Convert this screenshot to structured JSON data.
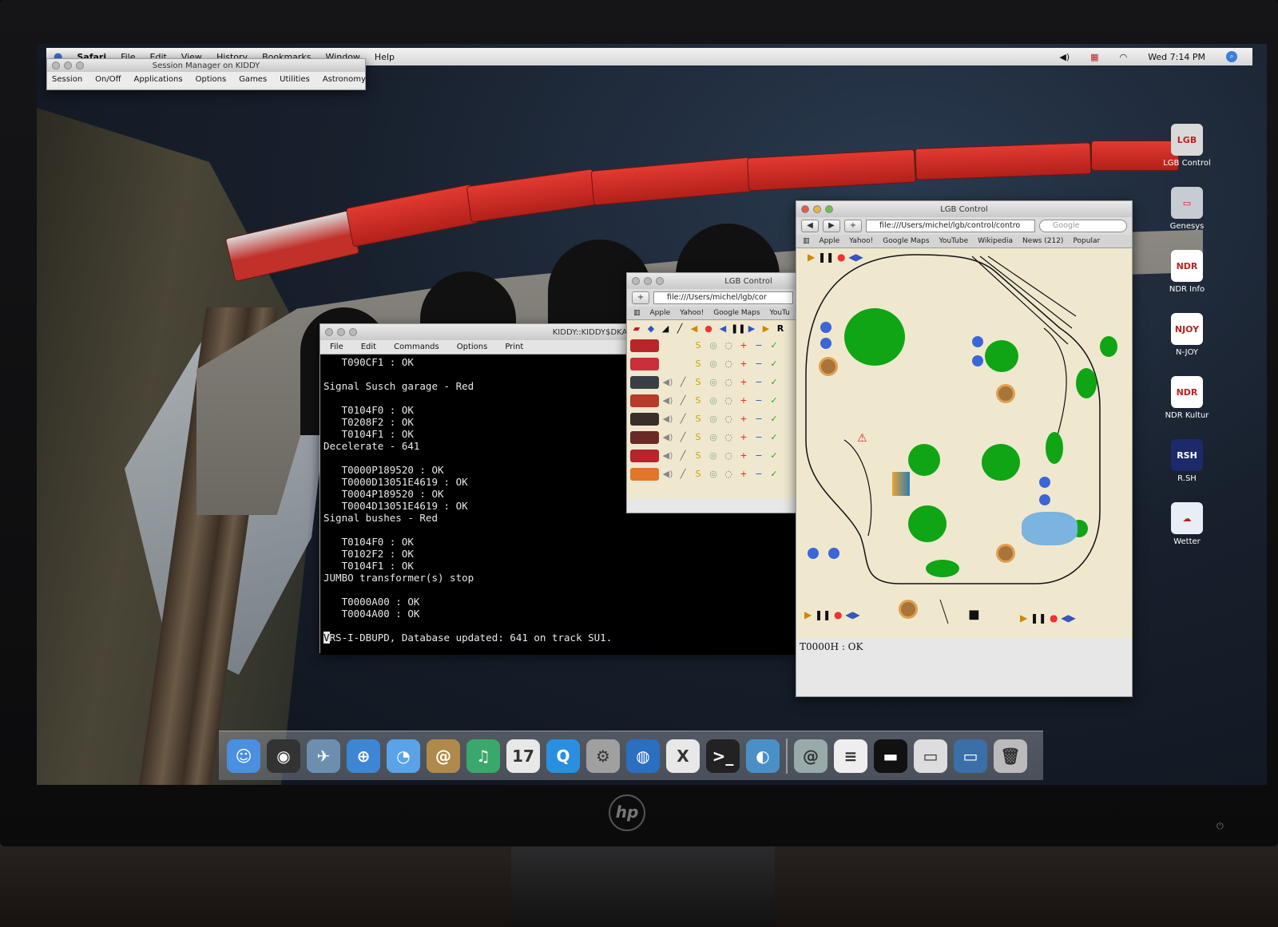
{
  "menubar": {
    "app": "Safari",
    "items": [
      "File",
      "Edit",
      "View",
      "History",
      "Bookmarks",
      "Window",
      "Help"
    ],
    "clock": "Wed 7:14 PM"
  },
  "session_manager": {
    "title": "Session Manager on KIDDY",
    "menu": [
      "Session",
      "On/Off",
      "Applications",
      "Options",
      "Games",
      "Utilities",
      "Astronomy"
    ]
  },
  "terminal": {
    "title": "KIDDY::KIDDY$DKA0:[",
    "menu": [
      "File",
      "Edit",
      "Commands",
      "Options",
      "Print"
    ],
    "lines": [
      "   T090CF1 : OK",
      "",
      "Signal Susch garage - Red",
      "",
      "   T0104F0 : OK",
      "   T0208F2 : OK",
      "   T0104F1 : OK",
      "Decelerate - 641",
      "",
      "   T0000P189520 : OK",
      "   T0000D13051E4619 : OK",
      "   T0004P189520 : OK",
      "   T0004D13051E4619 : OK",
      "Signal bushes - Red",
      "",
      "   T0104F0 : OK",
      "   T0102F2 : OK",
      "   T0104F1 : OK",
      "JUMBO transformer(s) stop",
      "",
      "   T0000A00 : OK",
      "   T0004A00 : OK",
      ""
    ],
    "last_line": "VRS-I-DBUPD, Database updated: 641 on track SU1."
  },
  "small_browser": {
    "title": "LGB Control",
    "url": "file:///Users/michel/lgb/cor",
    "bookmarks": [
      "Apple",
      "Yahoo!",
      "Google Maps",
      "YouTu"
    ],
    "loco_count": 8,
    "loco_colors": [
      "#b8262a",
      "#c9303a",
      "#3a3f46",
      "#b73a2a",
      "#3a2e2a",
      "#6b2a26",
      "#b8242a",
      "#e0762a"
    ]
  },
  "main_browser": {
    "title": "LGB Control",
    "url": "file:///Users/michel/lgb/control/contro",
    "search_placeholder": "Google",
    "bookmarks": [
      "Apple",
      "Yahoo!",
      "Google Maps",
      "YouTube",
      "Wikipedia",
      "News (212)",
      "Popular"
    ],
    "status": "T0000H : OK"
  },
  "desktop_icons": [
    {
      "label": "LGB Control",
      "color": "#d9d9d9",
      "glyph": "LGB"
    },
    {
      "label": "Genesys",
      "color": "#c7ccd2",
      "glyph": "▭"
    },
    {
      "label": "NDR Info",
      "color": "#ffffff",
      "glyph": "NDR"
    },
    {
      "label": "N-JOY",
      "color": "#ffffff",
      "glyph": "NJOY"
    },
    {
      "label": "NDR Kultur",
      "color": "#ffffff",
      "glyph": "NDR"
    },
    {
      "label": "R.SH",
      "color": "#1c2a6b",
      "glyph": "RSH"
    },
    {
      "label": "Wetter",
      "color": "#e8eef5",
      "glyph": "☁"
    }
  ],
  "dock": [
    {
      "name": "finder-icon",
      "color": "#4a8fe0",
      "glyph": "☺"
    },
    {
      "name": "dashboard-icon",
      "color": "#333",
      "glyph": "◉"
    },
    {
      "name": "mail-icon",
      "color": "#6c8fb0",
      "glyph": "✈"
    },
    {
      "name": "safari-icon",
      "color": "#3d86d4",
      "glyph": "⊕"
    },
    {
      "name": "ichat-icon",
      "color": "#5aa3e8",
      "glyph": "◔"
    },
    {
      "name": "address-book-icon",
      "color": "#b08a4a",
      "glyph": "@"
    },
    {
      "name": "itunes-icon",
      "color": "#3aa86a",
      "glyph": "♫"
    },
    {
      "name": "ical-icon",
      "color": "#e8e8e8",
      "glyph": "17"
    },
    {
      "name": "quicktime-icon",
      "color": "#2b8fe0",
      "glyph": "Q"
    },
    {
      "name": "system-prefs-icon",
      "color": "#a0a0a0",
      "glyph": "⚙"
    },
    {
      "name": "network-icon",
      "color": "#2a6fc0",
      "glyph": "◍"
    },
    {
      "name": "x11-icon",
      "color": "#e8e8e8",
      "glyph": "X"
    },
    {
      "name": "terminal-icon",
      "color": "#222",
      "glyph": ">_"
    },
    {
      "name": "network-utility-icon",
      "color": "#4a90c8",
      "glyph": "◐"
    },
    {
      "name": "mail-dock-icon",
      "color": "#9aa",
      "glyph": "@"
    },
    {
      "name": "document-icon",
      "color": "#eee",
      "glyph": "≡"
    },
    {
      "name": "screen-thumb-icon",
      "color": "#111",
      "glyph": "▬"
    },
    {
      "name": "window-thumb-icon",
      "color": "#ddd",
      "glyph": "▭"
    },
    {
      "name": "folder-icon",
      "color": "#3b6fa8",
      "glyph": "▭"
    },
    {
      "name": "trash-icon",
      "color": "#bbb",
      "glyph": "🗑"
    }
  ],
  "brand": "hp"
}
